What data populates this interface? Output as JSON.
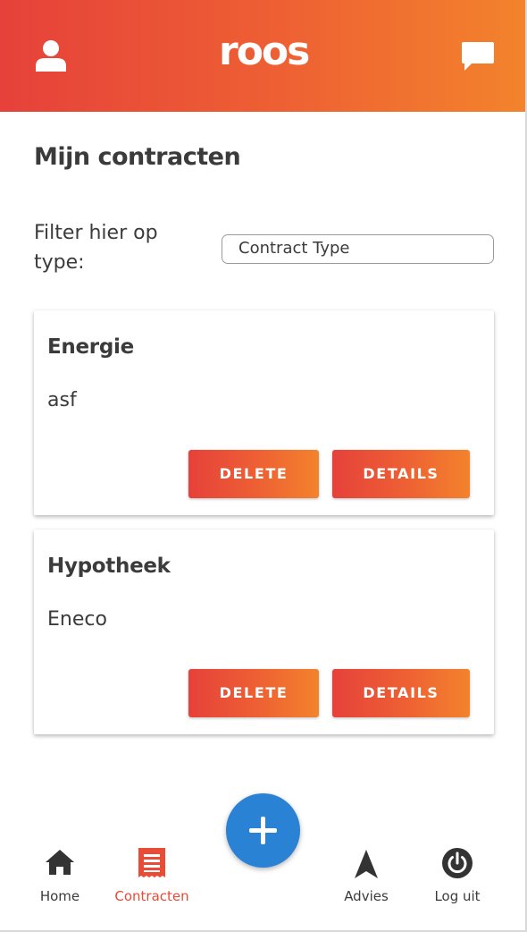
{
  "header": {
    "logo_text": "roos",
    "user_icon": "user-icon",
    "chat_icon": "chat-icon",
    "gradient_start": "#e6413a",
    "gradient_end": "#f3832c"
  },
  "page": {
    "title": "Mijn contracten"
  },
  "filter": {
    "label": "Filter hier op type:",
    "select_value": "Contract Type"
  },
  "contracts": [
    {
      "title": "Energie",
      "subtitle": "asf",
      "delete_label": "DELETE",
      "details_label": "DETAILS"
    },
    {
      "title": "Hypotheek",
      "subtitle": "Eneco",
      "delete_label": "DELETE",
      "details_label": "DETAILS"
    }
  ],
  "fab": {
    "icon": "plus-icon",
    "color": "#2a82d5"
  },
  "bottom_nav": {
    "items": [
      {
        "label": "Home",
        "icon": "home-icon",
        "active": false
      },
      {
        "label": "Contracten",
        "icon": "contract-list-icon",
        "active": true
      },
      {
        "label": "Advies",
        "icon": "navigation-arrow-icon",
        "active": false
      },
      {
        "label": "Log uit",
        "icon": "power-icon",
        "active": false
      }
    ],
    "active_color": "#ea4b37"
  }
}
